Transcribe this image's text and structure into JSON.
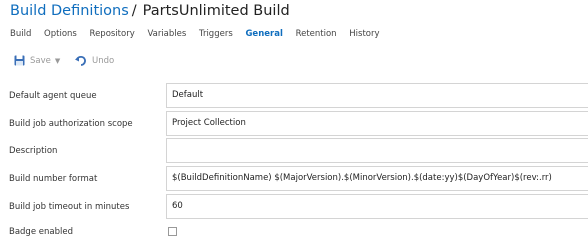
{
  "breadcrumb": {
    "root": "Build Definitions",
    "separator": "/",
    "current": "PartsUnlimited Build"
  },
  "tabs": [
    "Build",
    "Options",
    "Repository",
    "Variables",
    "Triggers",
    "General",
    "Retention",
    "History"
  ],
  "active_tab": "General",
  "toolbar": {
    "save_label": "Save",
    "undo_label": "Undo",
    "save_icon": "floppy-disk-icon",
    "undo_icon": "undo-arrow-icon"
  },
  "form": {
    "agent_queue": {
      "label": "Default agent queue",
      "value": "Default"
    },
    "auth_scope": {
      "label": "Build job authorization scope",
      "value": "Project Collection"
    },
    "description": {
      "label": "Description",
      "value": ""
    },
    "number_format": {
      "label": "Build number format",
      "value": "$(BuildDefinitionName) $(MajorVersion).$(MinorVersion).$(date:yy)$(DayOfYear)$(rev:.rr)"
    },
    "timeout": {
      "label": "Build job timeout in minutes",
      "value": "60"
    },
    "badge": {
      "label": "Badge enabled",
      "checked": false
    }
  },
  "colors": {
    "link": "#106ebe",
    "disabled": "#999999",
    "border": "#d4d4d4"
  }
}
